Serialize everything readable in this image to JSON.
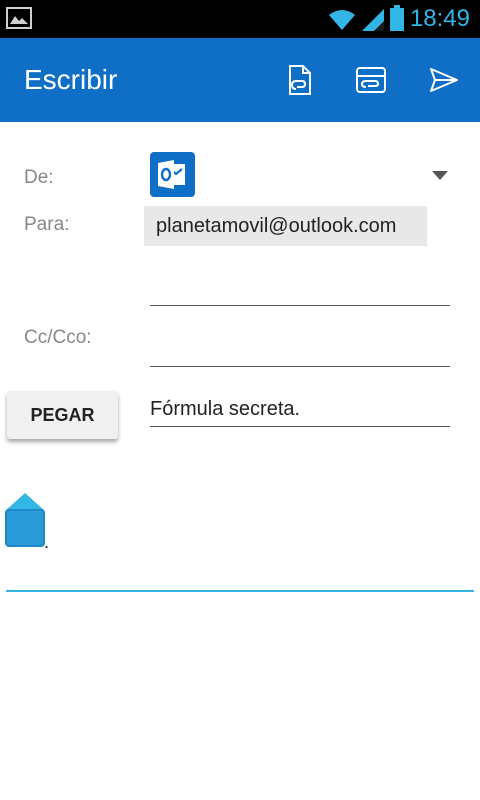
{
  "status_bar": {
    "time": "18:49",
    "icons": [
      "gallery-icon",
      "wifi-icon",
      "signal-icon",
      "battery-icon"
    ]
  },
  "app_bar": {
    "title": "Escribir",
    "actions": [
      "attach-document-icon",
      "attach-photo-icon",
      "send-icon"
    ],
    "color": "#0f6fc6"
  },
  "compose": {
    "from_label": "De:",
    "from_account_icon": "outlook-icon",
    "to_label": "Para:",
    "to_recipient": "planetamovil@outlook.com",
    "cc_label": "Cc/Cco:",
    "paste_button": "PEGAR",
    "subject": "Fórmula secreta.",
    "body": "."
  },
  "colors": {
    "accent": "#33b5e5",
    "brand": "#0f6fc6"
  }
}
